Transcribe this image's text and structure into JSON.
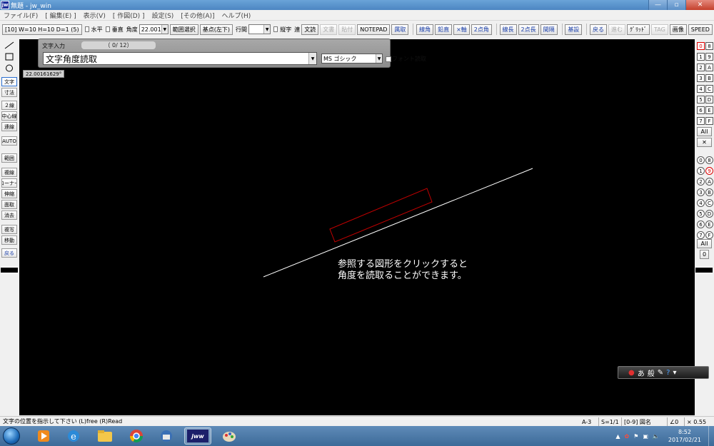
{
  "window": {
    "title": "無題 - jw_win",
    "app_icon_text": "jw",
    "controls": [
      "—",
      "▫",
      "✕"
    ]
  },
  "menu": [
    "ファイル(F)",
    "[ 編集(E) ]",
    "表示(V)",
    "[ 作図(D) ]",
    "設定(S)",
    "[その他(A)]",
    "ヘルプ(H)"
  ],
  "toolbar": {
    "scale_button": "[10]  W=10 H=10 D=1 (5)",
    "horizontal_label": "水平",
    "vertical_label": "垂直",
    "angle_label": "角度",
    "angle_value": "22.0016°",
    "range_select": "範囲選択",
    "base_point": "基点(左下)",
    "line_spacing_label": "行間",
    "line_spacing_value": "",
    "vertical_text_label": "縦字",
    "continuous": "連",
    "text_read": "文読",
    "text_write": "文書",
    "paste": "貼付",
    "notepad": "NOTEPAD",
    "right_buttons": [
      "属取",
      "線角",
      "鉛直",
      "×軸",
      "2点角",
      "線長",
      "2点長",
      "間隔",
      "基設"
    ],
    "extra_buttons": [
      "戻る",
      "進む",
      "ｸﾞﾘｯﾄﾞ",
      "TAG",
      "画像",
      "SPEED"
    ]
  },
  "left_tools": {
    "shapes": [
      "line-icon",
      "rectangle-icon",
      "circle-icon"
    ],
    "group1": [
      "文字",
      "寸法"
    ],
    "group2": [
      "２線",
      "中心線",
      "連線",
      "AUTO"
    ],
    "group3": [
      "範囲",
      "複線",
      "コーナー",
      "伸縮",
      "面取",
      "消去",
      "複写",
      "移動",
      "戻る"
    ]
  },
  "right_layers": {
    "group_rows": [
      [
        "0",
        "8"
      ],
      [
        "1",
        "9"
      ],
      [
        "2",
        "A"
      ],
      [
        "3",
        "B"
      ],
      [
        "4",
        "C"
      ],
      [
        "5",
        "D"
      ],
      [
        "6",
        "E"
      ],
      [
        "7",
        "F"
      ]
    ],
    "all_label": "All",
    "cross_label": "✕",
    "layer_rows": [
      [
        "0",
        "8"
      ],
      [
        "1",
        "9"
      ],
      [
        "2",
        "A"
      ],
      [
        "3",
        "B"
      ],
      [
        "4",
        "C"
      ],
      [
        "5",
        "D"
      ],
      [
        "6",
        "E"
      ],
      [
        "7",
        "F"
      ]
    ],
    "layer_all_label": "All",
    "layer_zero_label": "0"
  },
  "text_dialog": {
    "title": "文字入力",
    "count": "（  0/  12）",
    "input_value": "文字角度読取",
    "font_value": "MS ゴシック",
    "font_read_label": "フォント読取"
  },
  "angle_tooltip": "22.00161629°",
  "drawing_text": [
    "参照する図形をクリックすると",
    "角度を読取ることができます。"
  ],
  "colors": {
    "canvas": "#000000",
    "reference_line": "#ffffff",
    "text_frame": "#c00000"
  },
  "ime": {
    "items": [
      "あ",
      "般"
    ]
  },
  "status": {
    "message": "文字の位置を指示して下さい (L)free (R)Read",
    "paper": "A-3",
    "scale": "S=1/1",
    "layer_group": "[0-9] 図名",
    "angle": "∠0",
    "factor": "× 0.55"
  },
  "taskbar": {
    "apps": [
      "media-player-icon",
      "ie-icon",
      "explorer-icon",
      "chrome-icon",
      "thunderbird-icon",
      "jw-cad-icon",
      "paint-icon"
    ],
    "active_app_label": "jww",
    "time": "8:52",
    "date": "2017/02/21"
  }
}
